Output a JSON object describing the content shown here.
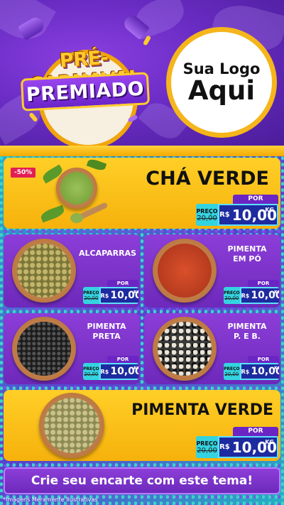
{
  "header": {
    "title_line1": "PRÉ-CARNAVAL",
    "title_line2": "PREMIADO",
    "logo_line1": "Sua Logo",
    "logo_line2": "Aqui"
  },
  "featured_top": {
    "badge": "-50%",
    "name": "CHÁ VERDE",
    "por_label": "POR",
    "preco_label": "PREÇO",
    "old_price": "20,00",
    "currency": "R$",
    "price": "10,00",
    "unit": "KG"
  },
  "products": [
    {
      "name_line1": "ALCAPARRAS",
      "name_line2": "",
      "por_label": "POR",
      "preco_label": "PREÇO",
      "old_price": "20,00",
      "currency": "R$",
      "price": "10,00",
      "unit": "KG"
    },
    {
      "name_line1": "PIMENTA",
      "name_line2": "EM PÓ",
      "por_label": "POR",
      "preco_label": "PREÇO",
      "old_price": "20,00",
      "currency": "R$",
      "price": "10,00",
      "unit": "KG"
    },
    {
      "name_line1": "PIMENTA",
      "name_line2": "PRETA",
      "por_label": "POR",
      "preco_label": "PREÇO",
      "old_price": "20,00",
      "currency": "R$",
      "price": "10,00",
      "unit": "KG"
    },
    {
      "name_line1": "PIMENTA",
      "name_line2": "P. E B.",
      "por_label": "POR",
      "preco_label": "PREÇO",
      "old_price": "20,00",
      "currency": "R$",
      "price": "10,00",
      "unit": "KG"
    }
  ],
  "featured_bottom": {
    "name": "PIMENTA VERDE",
    "por_label": "POR",
    "preco_label": "PREÇO",
    "old_price": "20,00",
    "currency": "R$",
    "price": "10,00",
    "unit": "KG"
  },
  "cta": "Crie seu encarte com este tema!",
  "footnote": "*Imagens Meramente Ilustrativas",
  "colors": {
    "purple": "#6d29bb",
    "yellow": "#f6b10c",
    "price_blue": "#1d2ba0",
    "price_cyan": "#34d3e0"
  }
}
